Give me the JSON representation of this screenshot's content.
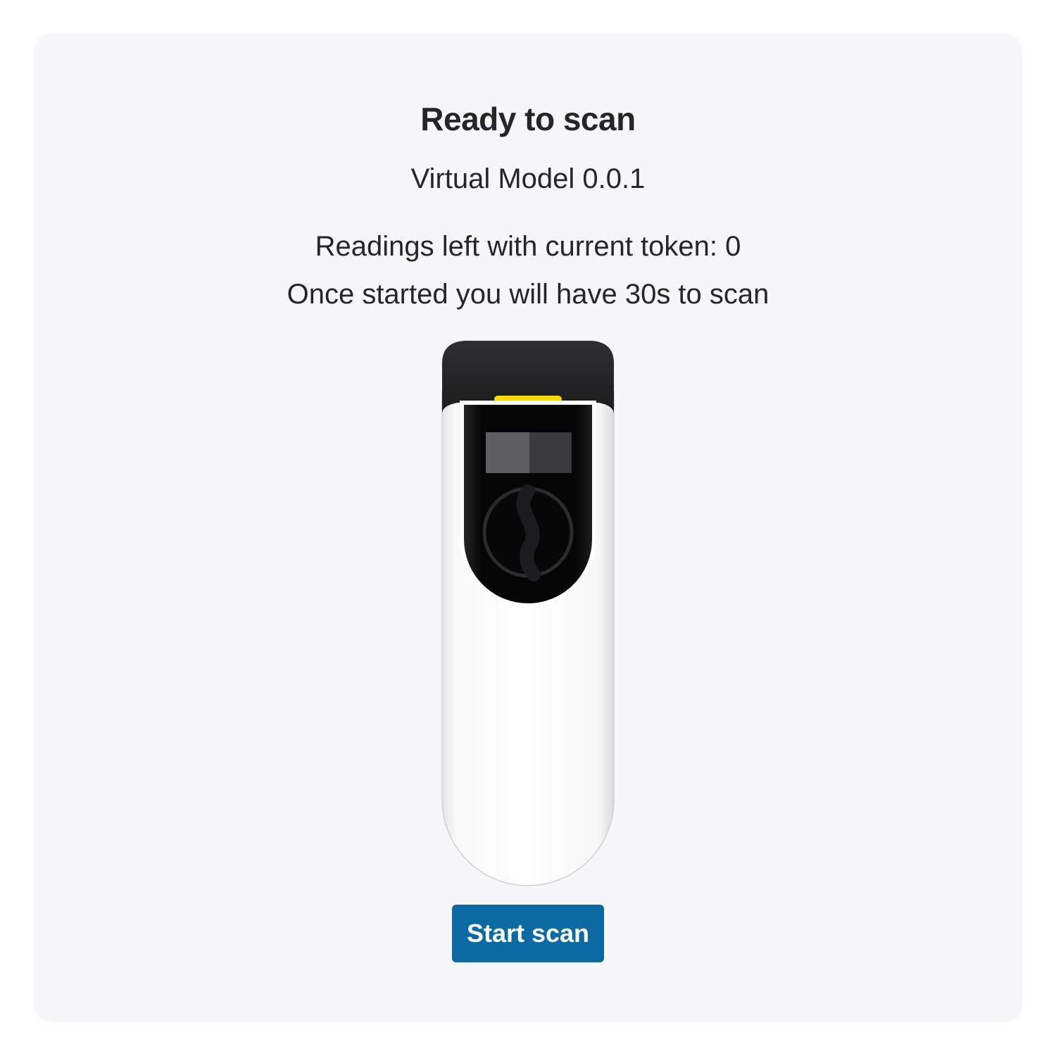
{
  "header": {
    "title": "Ready to scan",
    "model": "Virtual Model 0.0.1"
  },
  "info": {
    "readings_left": "Readings left with current token: 0",
    "time_limit": "Once started you will have 30s to scan"
  },
  "device": {
    "icon": "fingerprint-scanner-device",
    "status_led_color": "#f5d90a"
  },
  "actions": {
    "start_label": "Start scan",
    "accent_color": "#0a6aa1"
  }
}
